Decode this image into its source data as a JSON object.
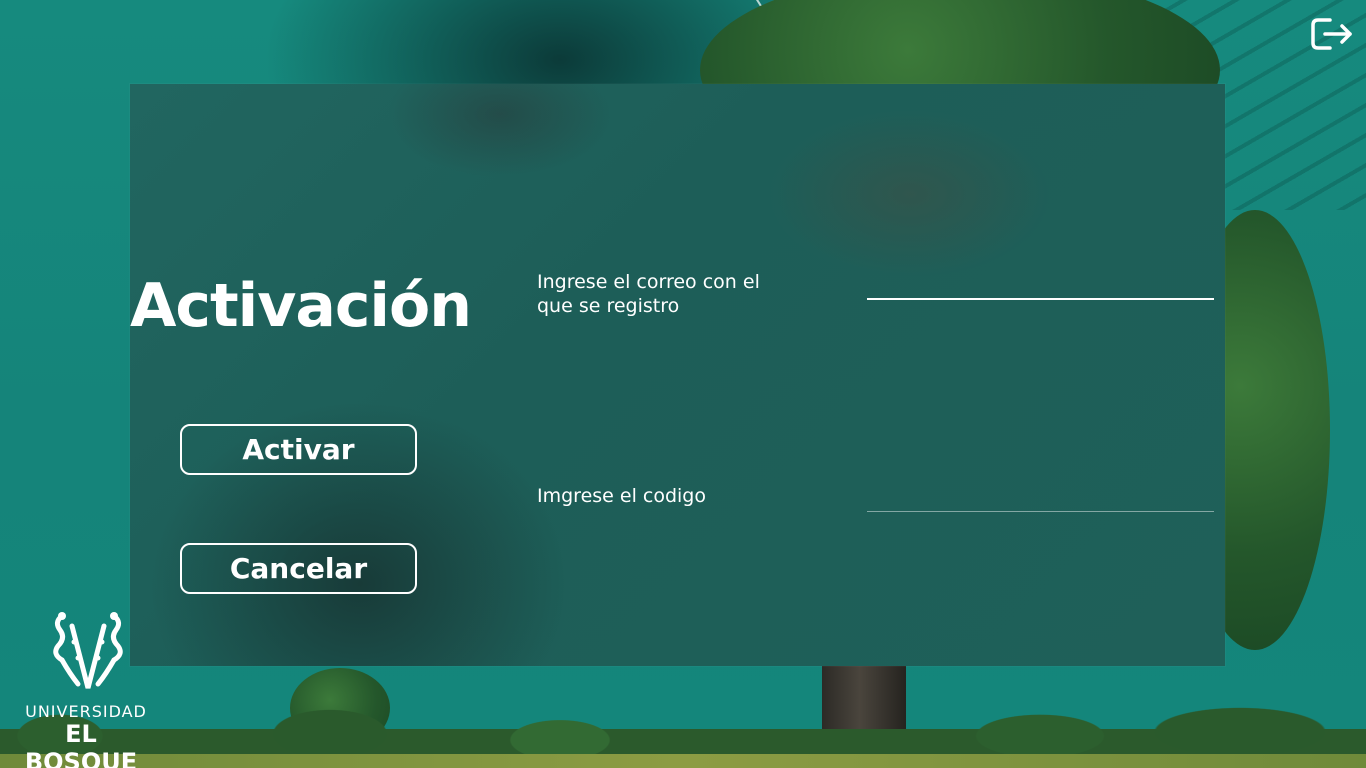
{
  "window": {
    "width": 1366,
    "height": 768
  },
  "page": {
    "title": "Activación"
  },
  "form": {
    "email_label": "Ingrese el correo con el que se registro",
    "email_value": "",
    "code_label": "Imgrese el codigo",
    "code_value": ""
  },
  "buttons": {
    "activate_label": "Activar",
    "cancel_label": "Cancelar"
  },
  "header": {
    "logout_icon": "logout-icon"
  },
  "logo": {
    "line1": "UNIVERSIDAD",
    "line2": "EL BOSQUE"
  },
  "colors": {
    "background": "#17877c",
    "panel": "#1f6059",
    "text": "#ffffff"
  }
}
